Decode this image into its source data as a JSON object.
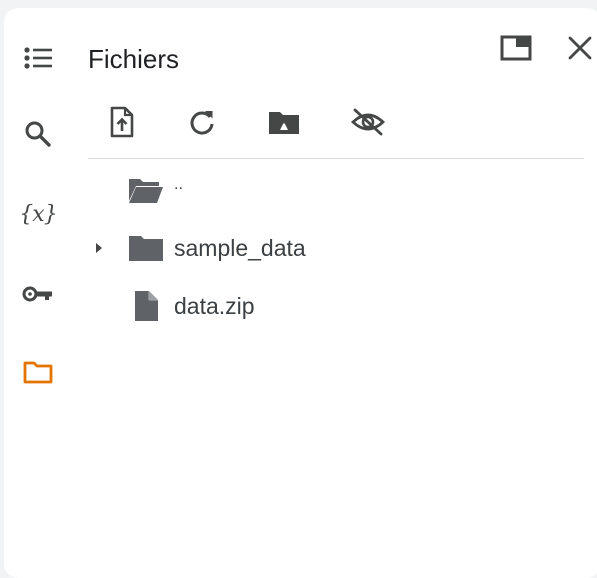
{
  "panel": {
    "title": "Fichiers"
  },
  "rail": {
    "items": [
      {
        "name": "toc",
        "icon": "list-icon"
      },
      {
        "name": "search",
        "icon": "search-icon"
      },
      {
        "name": "variables",
        "icon": "variables-icon",
        "glyph": "{x}"
      },
      {
        "name": "secrets",
        "icon": "key-icon"
      },
      {
        "name": "files",
        "icon": "folder-outline-icon",
        "active": true
      }
    ],
    "active_color": "#e37400"
  },
  "header": {
    "undock_icon": "open-in-new-window-icon",
    "close_icon": "close-icon"
  },
  "toolbar": {
    "buttons": [
      {
        "name": "upload",
        "icon": "upload-file-icon"
      },
      {
        "name": "refresh",
        "icon": "refresh-icon"
      },
      {
        "name": "mount-drive",
        "icon": "drive-folder-icon"
      },
      {
        "name": "toggle-hidden",
        "icon": "visibility-off-icon"
      }
    ]
  },
  "tree": {
    "parent_label": "..",
    "items": [
      {
        "label": "sample_data",
        "type": "folder",
        "expandable": true
      },
      {
        "label": "data.zip",
        "type": "file",
        "expandable": false
      }
    ]
  },
  "colors": {
    "icon": "#444746",
    "folder": "#5f6368",
    "accent": "#e37400"
  }
}
